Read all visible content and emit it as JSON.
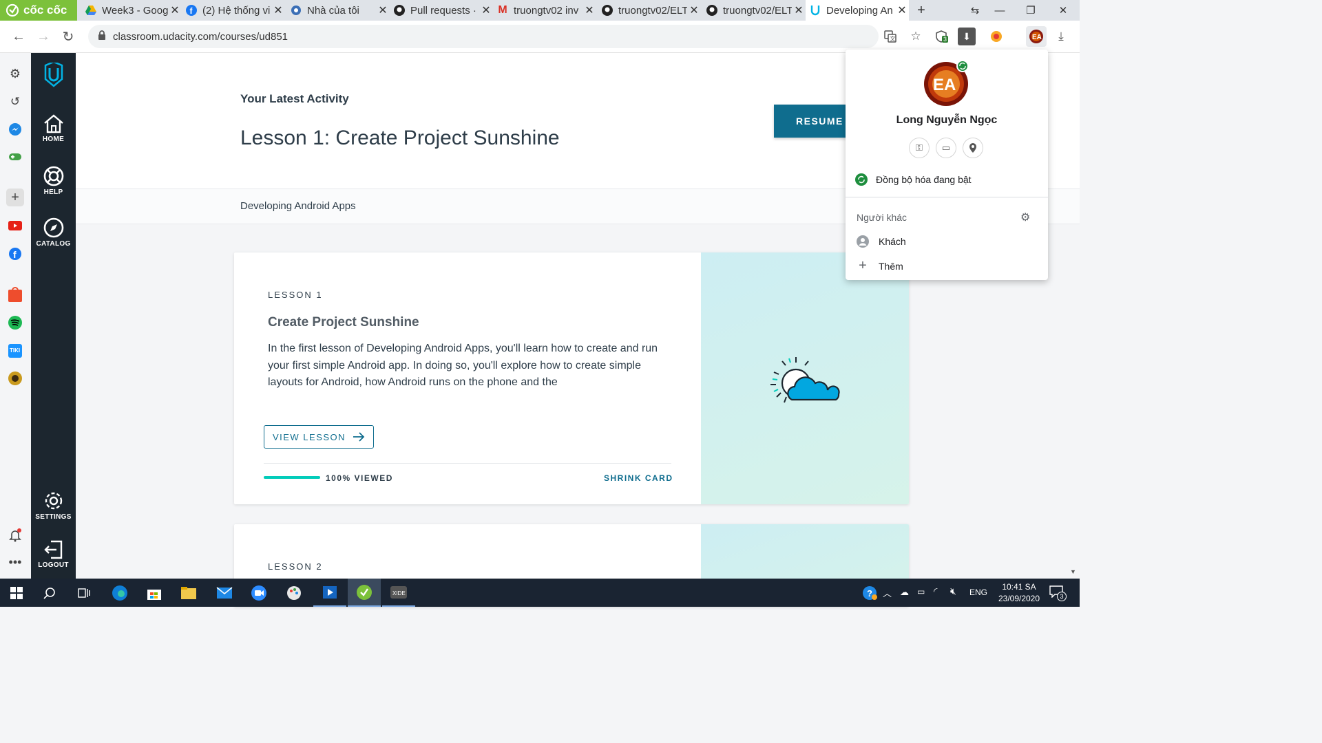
{
  "browser": {
    "brand": "cốc cốc",
    "tabs": [
      {
        "label": "Week3 - Googl",
        "icon": "google-drive-icon"
      },
      {
        "label": "(2) Hệ thống vi",
        "icon": "facebook-icon"
      },
      {
        "label": "Nhà của tôi",
        "icon": "globe-icon"
      },
      {
        "label": "Pull requests · ",
        "icon": "github-icon"
      },
      {
        "label": "truongtv02 inv",
        "icon": "gmail-icon"
      },
      {
        "label": "truongtv02/ELT",
        "icon": "github-icon"
      },
      {
        "label": "truongtv02/ELT",
        "icon": "github-icon"
      },
      {
        "label": "Developing An",
        "icon": "udacity-icon"
      }
    ],
    "url": "classroom.udacity.com/courses/ud851",
    "extension_badge": "3"
  },
  "udacity_nav": {
    "home": "HOME",
    "help": "HELP",
    "catalog": "CATALOG",
    "settings": "SETTINGS",
    "logout": "LOGOUT"
  },
  "header": {
    "latest_activity": "Your Latest Activity",
    "lesson_title": "Lesson 1: Create Project Sunshine",
    "resume_button": "RESUME L"
  },
  "subbar": {
    "course_name": "Developing Android Apps"
  },
  "lessons": [
    {
      "number_label": "LESSON 1",
      "title": "Create Project Sunshine",
      "description": "In the first lesson of Developing Android Apps, you'll learn how to create and run your first simple Android app. In doing so, you'll explore how to create simple layouts for Android, how Android runs on the phone and the",
      "view_button": "VIEW LESSON",
      "progress_label": "100% VIEWED",
      "progress": 1.0,
      "shrink_label": "SHRINK CARD"
    },
    {
      "number_label": "LESSON 2"
    }
  ],
  "profile_popup": {
    "name": "Long Nguyễn Ngọc",
    "sync_status": "Đồng bộ hóa đang bật",
    "others_label": "Người khác",
    "guest_label": "Khách",
    "add_label": "Thêm"
  },
  "taskbar": {
    "language": "ENG",
    "time": "10:41 SA",
    "date": "23/09/2020",
    "notification_count": "3"
  },
  "colors": {
    "udacity_nav_bg": "#1c262f",
    "udacity_accent": "#02b3e4",
    "resume_button_bg": "#0f6d8e",
    "progress_green": "#02ccba",
    "brand_green": "#7cc13b"
  }
}
